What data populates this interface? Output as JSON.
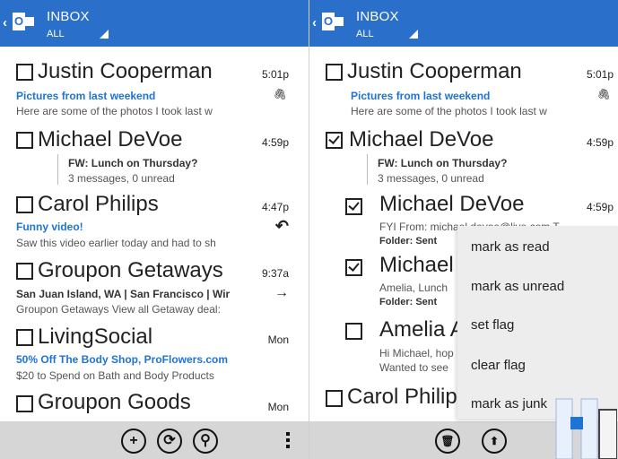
{
  "colors": {
    "header": "#2a6fc9",
    "link_blue": "#1e73d6",
    "appbar": "#d6d6d6"
  },
  "left": {
    "header": {
      "back_glyph": "‹",
      "app_icon": "outlook-icon",
      "title": "INBOX",
      "filter": "ALL"
    },
    "messages": [
      {
        "sender": "Justin Cooperman",
        "time": "5:01p",
        "subject": "Pictures from last weekend",
        "preview": "Here are some of the photos I took last w",
        "status": "paperclip-icon",
        "status_glyph": "🖇",
        "checked": false
      },
      {
        "sender": "Michael DeVoe",
        "time": "4:59p",
        "subject": "FW: Lunch on Thursday?",
        "preview": "3 messages, 0 unread",
        "status": "",
        "checked": false
      },
      {
        "sender": "Carol Philips",
        "time": "4:47p",
        "subject": "Funny video!",
        "preview": "Saw this video earlier today and had to sh",
        "status": "reply-icon",
        "status_glyph": "↶",
        "checked": false
      },
      {
        "sender": "Groupon Getaways",
        "time": "9:37a",
        "subject": "San Juan Island, WA | San Francisco | Wir",
        "preview": "Groupon Getaways View all Getaway deal:",
        "status": "forward-icon",
        "status_glyph": "→",
        "checked": false
      },
      {
        "sender": "LivingSocial",
        "time": "Mon",
        "subject": "50% Off The Body Shop, ProFlowers.com",
        "preview": "$20 to Spend on Bath and Body Products",
        "status": "",
        "checked": false
      },
      {
        "sender": "Groupon Goods",
        "time": "Mon",
        "subject": "",
        "preview": "",
        "status": "",
        "checked": false
      }
    ],
    "appbar": {
      "new_glyph": "+",
      "sync_glyph": "⟳",
      "search_glyph": "⚲"
    }
  },
  "right": {
    "header": {
      "back_glyph": "‹",
      "app_icon": "outlook-icon",
      "title": "INBOX",
      "filter": "ALL"
    },
    "messages": [
      {
        "sender": "Justin Cooperman",
        "time": "5:01p",
        "subject": "Pictures from last weekend",
        "preview": "Here are some of the photos I took last w",
        "status_glyph": "🖇",
        "checked": false
      },
      {
        "sender": "Michael DeVoe",
        "time": "4:59p",
        "subject": "FW: Lunch on Thursday?",
        "preview": "3 messages, 0 unread",
        "checked": true
      },
      {
        "sender": "Michael DeVoe",
        "time": "4:59p",
        "subject": "FYI From: michael.devoe@live.com T",
        "preview": "Folder: Sent",
        "checked": true
      },
      {
        "sender": "Michael",
        "time": "",
        "subject": "Amelia, Lunch",
        "preview": "Folder: Sent",
        "checked": true
      },
      {
        "sender": "Amelia A",
        "time": "",
        "subject": "Hi Michael, hop",
        "preview": "Wanted to see",
        "checked": false
      },
      {
        "sender": "Carol Philip",
        "time": "",
        "subject": "",
        "preview": "",
        "checked": false
      }
    ],
    "appbar": {
      "delete_glyph": "🗑",
      "move_glyph": "⬆"
    }
  },
  "context_menu": {
    "items": [
      "mark as read",
      "mark as unread",
      "set flag",
      "clear flag",
      "mark as junk"
    ]
  }
}
